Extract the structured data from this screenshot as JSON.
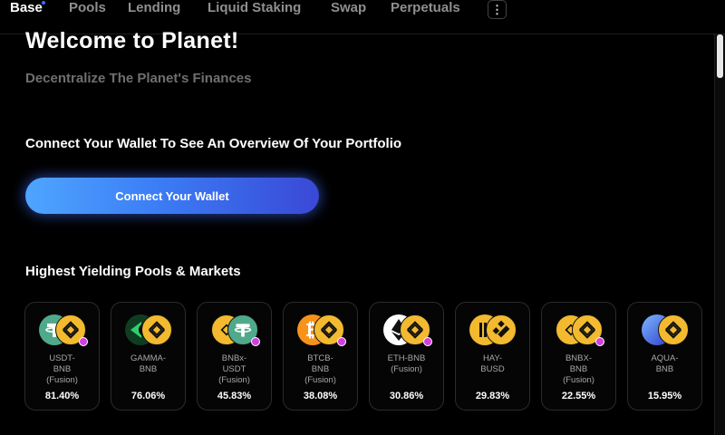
{
  "nav": {
    "items": [
      "Base",
      "Pools",
      "Lending",
      "Liquid Staking",
      "Swap",
      "Perpetuals"
    ],
    "active": "Base",
    "more_label": "⋮"
  },
  "hero": {
    "title": "Welcome to Planet!",
    "subtitle": "Decentralize The Planet's Finances"
  },
  "wallet": {
    "heading": "Connect Your Wallet To See An Overview Of Your Portfolio",
    "button_label": "Connect Your Wallet"
  },
  "pools": {
    "heading": "Highest Yielding Pools & Markets",
    "cards": [
      {
        "name": "USDT-\nBNB\n(Fusion)",
        "apr": "81.40%",
        "token_a": "usdt-icon",
        "token_b": "bnb-icon",
        "fusion": true
      },
      {
        "name": "GAMMA-\nBNB",
        "apr": "76.06%",
        "token_a": "gamma-icon",
        "token_b": "bnb-icon",
        "fusion": false
      },
      {
        "name": "BNBx-\nUSDT\n(Fusion)",
        "apr": "45.83%",
        "token_a": "bnbx-icon",
        "token_b": "usdt-icon",
        "fusion": true
      },
      {
        "name": "BTCB-\nBNB\n(Fusion)",
        "apr": "38.08%",
        "token_a": "btcb-icon",
        "token_b": "bnb-icon",
        "fusion": true
      },
      {
        "name": "ETH-BNB\n(Fusion)",
        "apr": "30.86%",
        "token_a": "eth-icon",
        "token_b": "bnb-icon",
        "fusion": true
      },
      {
        "name": "HAY-\nBUSD",
        "apr": "29.83%",
        "token_a": "hay-icon",
        "token_b": "busd-icon",
        "fusion": false
      },
      {
        "name": "BNBX-\nBNB\n(Fusion)",
        "apr": "22.55%",
        "token_a": "bnbx-icon",
        "token_b": "bnb-icon",
        "fusion": true
      },
      {
        "name": "AQUA-\nBNB",
        "apr": "15.95%",
        "token_a": "aqua-icon",
        "token_b": "bnb-icon",
        "fusion": false
      }
    ]
  },
  "colors": {
    "accent_blue": "#3b7df5",
    "bnb_yellow": "#f3ba2f",
    "usdt_green": "#4fa98a",
    "fusion_badge": "#d23fe0"
  }
}
